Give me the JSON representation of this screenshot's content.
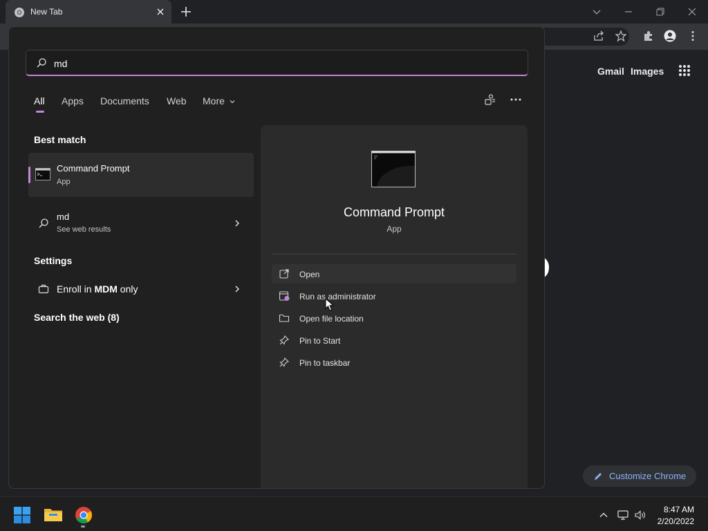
{
  "browser": {
    "tab_title": "New Tab",
    "links": {
      "gmail": "Gmail",
      "images": "Images"
    },
    "customize_label": "Customize Chrome"
  },
  "search": {
    "query": "md",
    "tabs": [
      {
        "label": "All",
        "active": true
      },
      {
        "label": "Apps"
      },
      {
        "label": "Documents"
      },
      {
        "label": "Web"
      },
      {
        "label": "More"
      }
    ],
    "sections": {
      "best_match": "Best match",
      "settings": "Settings",
      "search_web": "Search the web (8)"
    },
    "best_match_item": {
      "title": "Command Prompt",
      "subtitle": "App"
    },
    "web_item": {
      "title": "md",
      "subtitle": "See web results"
    },
    "settings_item": {
      "prefix": "Enroll in ",
      "highlight": "MDM",
      "suffix": " only"
    },
    "details": {
      "title": "Command Prompt",
      "subtitle": "App",
      "actions": [
        {
          "label": "Open",
          "icon": "open-icon"
        },
        {
          "label": "Run as administrator",
          "icon": "admin-shield-icon"
        },
        {
          "label": "Open file location",
          "icon": "folder-icon"
        },
        {
          "label": "Pin to Start",
          "icon": "pin-icon"
        },
        {
          "label": "Pin to taskbar",
          "icon": "pin-icon"
        }
      ]
    }
  },
  "taskbar": {
    "time": "8:47 AM",
    "date": "2/20/2022"
  },
  "colors": {
    "accent": "#c587d6",
    "chrome_link": "#8ab4f8",
    "panel_bg": "#202020",
    "detail_bg": "#2b2b2b"
  }
}
